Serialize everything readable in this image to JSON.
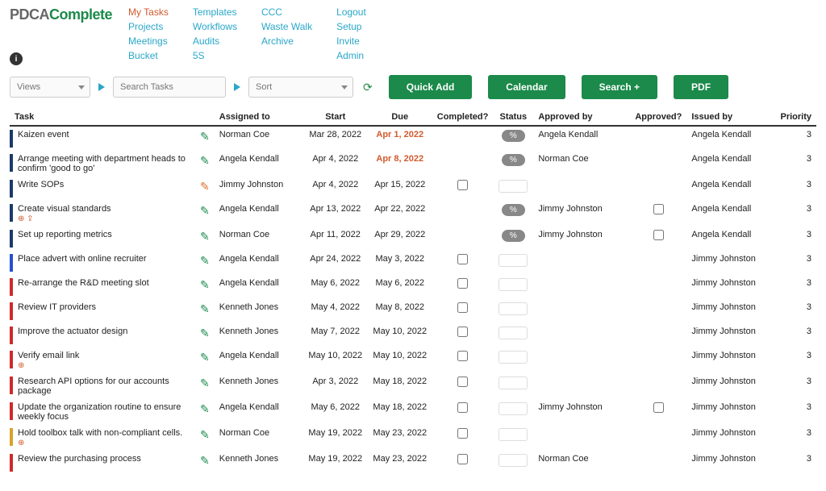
{
  "logo": {
    "part1": "PDCA",
    "part2": "Complete"
  },
  "nav": {
    "col1": [
      "My Tasks",
      "Projects",
      "Meetings",
      "Bucket"
    ],
    "col2": [
      "Templates",
      "Workflows",
      "Audits",
      "5S"
    ],
    "col3": [
      "CCC",
      "Waste Walk",
      "Archive"
    ],
    "col4": [
      "Logout",
      "Setup",
      "Invite",
      "Admin"
    ]
  },
  "toolbar": {
    "views": "Views",
    "search_placeholder": "Search Tasks",
    "sort": "Sort",
    "quick_add": "Quick Add",
    "calendar": "Calendar",
    "search_btn": "Search +",
    "pdf": "PDF"
  },
  "columns": {
    "task": "Task",
    "assigned_to": "Assigned to",
    "start": "Start",
    "due": "Due",
    "completed": "Completed?",
    "status": "Status",
    "approved_by": "Approved by",
    "approved": "Approved?",
    "issued_by": "Issued by",
    "priority": "Priority"
  },
  "rows": [
    {
      "color": "#1b3a6a",
      "task": "Kaizen event",
      "icons": "",
      "pencil": "green",
      "assigned": "Norman Coe",
      "start": "Mar 28, 2022",
      "due": "Apr 1, 2022",
      "due_over": true,
      "completed": "",
      "status": "badge",
      "approved_by": "Angela Kendall",
      "approved": "",
      "issued": "Angela Kendall",
      "priority": "3"
    },
    {
      "color": "#1b3a6a",
      "task": "Arrange meeting with department heads to confirm 'good to go'",
      "icons": "",
      "pencil": "green",
      "assigned": "Angela Kendall",
      "start": "Apr 4, 2022",
      "due": "Apr 8, 2022",
      "due_over": true,
      "completed": "",
      "status": "badge",
      "approved_by": "Norman Coe",
      "approved": "",
      "issued": "Angela Kendall",
      "priority": "3"
    },
    {
      "color": "#1b3a6a",
      "task": "Write SOPs",
      "icons": "",
      "pencil": "orange",
      "assigned": "Jimmy Johnston",
      "start": "Apr 4, 2022",
      "due": "Apr 15, 2022",
      "due_over": false,
      "completed": "cb",
      "status": "box",
      "approved_by": "",
      "approved": "",
      "issued": "Angela Kendall",
      "priority": "3"
    },
    {
      "color": "#1b3a6a",
      "task": "Create visual standards",
      "icons": "⊕ ⇪",
      "pencil": "green",
      "assigned": "Angela Kendall",
      "start": "Apr 13, 2022",
      "due": "Apr 22, 2022",
      "due_over": false,
      "completed": "",
      "status": "badge",
      "approved_by": "Jimmy Johnston",
      "approved": "cb",
      "issued": "Angela Kendall",
      "priority": "3"
    },
    {
      "color": "#1b3a6a",
      "task": "Set up reporting metrics",
      "icons": "",
      "pencil": "green",
      "assigned": "Norman Coe",
      "start": "Apr 11, 2022",
      "due": "Apr 29, 2022",
      "due_over": false,
      "completed": "",
      "status": "badge",
      "approved_by": "Jimmy Johnston",
      "approved": "cb",
      "issued": "Angela Kendall",
      "priority": "3"
    },
    {
      "color": "#2a4fd0",
      "task": "Place advert with online recruiter",
      "icons": "",
      "pencil": "green",
      "assigned": "Angela Kendall",
      "start": "Apr 24, 2022",
      "due": "May 3, 2022",
      "due_over": false,
      "completed": "cb",
      "status": "box",
      "approved_by": "",
      "approved": "",
      "issued": "Jimmy Johnston",
      "priority": "3"
    },
    {
      "color": "#d02a2a",
      "task": "Re-arrange the R&D meeting slot",
      "icons": "",
      "pencil": "green",
      "assigned": "Angela Kendall",
      "start": "May 6, 2022",
      "due": "May 6, 2022",
      "due_over": false,
      "completed": "cb",
      "status": "box",
      "approved_by": "",
      "approved": "",
      "issued": "Jimmy Johnston",
      "priority": "3"
    },
    {
      "color": "#d02a2a",
      "task": "Review IT providers",
      "icons": "",
      "pencil": "green",
      "assigned": "Kenneth Jones",
      "start": "May 4, 2022",
      "due": "May 8, 2022",
      "due_over": false,
      "completed": "cb",
      "status": "box",
      "approved_by": "",
      "approved": "",
      "issued": "Jimmy Johnston",
      "priority": "3"
    },
    {
      "color": "#d02a2a",
      "task": "Improve the actuator design",
      "icons": "",
      "pencil": "green",
      "assigned": "Kenneth Jones",
      "start": "May 7, 2022",
      "due": "May 10, 2022",
      "due_over": false,
      "completed": "cb",
      "status": "box",
      "approved_by": "",
      "approved": "",
      "issued": "Jimmy Johnston",
      "priority": "3"
    },
    {
      "color": "#d02a2a",
      "task": "Verify email link",
      "icons": "⊕",
      "pencil": "green",
      "assigned": "Angela Kendall",
      "start": "May 10, 2022",
      "due": "May 10, 2022",
      "due_over": false,
      "completed": "cb",
      "status": "box",
      "approved_by": "",
      "approved": "",
      "issued": "Jimmy Johnston",
      "priority": "3"
    },
    {
      "color": "#d02a2a",
      "task": "Research API options for our accounts package",
      "icons": "",
      "pencil": "green",
      "assigned": "Kenneth Jones",
      "start": "Apr 3, 2022",
      "due": "May 18, 2022",
      "due_over": false,
      "completed": "cb",
      "status": "box",
      "approved_by": "",
      "approved": "",
      "issued": "Jimmy Johnston",
      "priority": "3"
    },
    {
      "color": "#d02a2a",
      "task": "Update the organization routine to ensure weekly focus",
      "icons": "",
      "pencil": "green",
      "assigned": "Angela Kendall",
      "start": "May 6, 2022",
      "due": "May 18, 2022",
      "due_over": false,
      "completed": "cb",
      "status": "box",
      "approved_by": "Jimmy Johnston",
      "approved": "cb",
      "issued": "Jimmy Johnston",
      "priority": "3"
    },
    {
      "color": "#d8a32a",
      "task": "Hold toolbox talk with non-compliant cells.",
      "icons": "⊕",
      "pencil": "green",
      "assigned": "Norman Coe",
      "start": "May 19, 2022",
      "due": "May 23, 2022",
      "due_over": false,
      "completed": "cb",
      "status": "box",
      "approved_by": "",
      "approved": "",
      "issued": "Jimmy Johnston",
      "priority": "3"
    },
    {
      "color": "#d02a2a",
      "task": "Review the purchasing process",
      "icons": "",
      "pencil": "green",
      "assigned": "Kenneth Jones",
      "start": "May 19, 2022",
      "due": "May 23, 2022",
      "due_over": false,
      "completed": "cb",
      "status": "box",
      "approved_by": "Norman Coe",
      "approved": "",
      "issued": "Jimmy Johnston",
      "priority": "3"
    }
  ],
  "status_badge_text": "%"
}
